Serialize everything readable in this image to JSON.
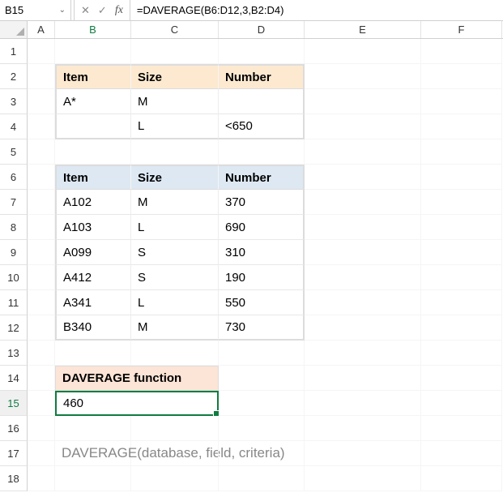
{
  "nameBox": "B15",
  "formula": "=DAVERAGE(B6:D12,3,B2:D4)",
  "columns": [
    "A",
    "B",
    "C",
    "D",
    "E",
    "F"
  ],
  "criteria": {
    "headers": [
      "Item",
      "Size",
      "Number"
    ],
    "rows": [
      {
        "item": "A*",
        "size": "M",
        "number": ""
      },
      {
        "item": "",
        "size": "L",
        "number": "<650"
      }
    ]
  },
  "data": {
    "headers": [
      "Item",
      "Size",
      "Number"
    ],
    "rows": [
      {
        "item": "A102",
        "size": "M",
        "number": "370"
      },
      {
        "item": "A103",
        "size": "L",
        "number": "690"
      },
      {
        "item": "A099",
        "size": "S",
        "number": "310"
      },
      {
        "item": "A412",
        "size": "S",
        "number": "190"
      },
      {
        "item": "A341",
        "size": "L",
        "number": "550"
      },
      {
        "item": "B340",
        "size": "M",
        "number": "730"
      }
    ]
  },
  "result": {
    "title": "DAVERAGE function",
    "value": "460"
  },
  "syntax": "DAVERAGE(database, field, criteria)",
  "chart_data": {
    "type": "table",
    "criteria": [
      [
        "Item",
        "Size",
        "Number"
      ],
      [
        "A*",
        "M",
        ""
      ],
      [
        "",
        "L",
        "<650"
      ]
    ],
    "database": [
      [
        "Item",
        "Size",
        "Number"
      ],
      [
        "A102",
        "M",
        370
      ],
      [
        "A103",
        "L",
        690
      ],
      [
        "A099",
        "S",
        310
      ],
      [
        "A412",
        "S",
        190
      ],
      [
        "A341",
        "L",
        550
      ],
      [
        "B340",
        "M",
        730
      ]
    ],
    "function": "DAVERAGE",
    "result": 460
  }
}
